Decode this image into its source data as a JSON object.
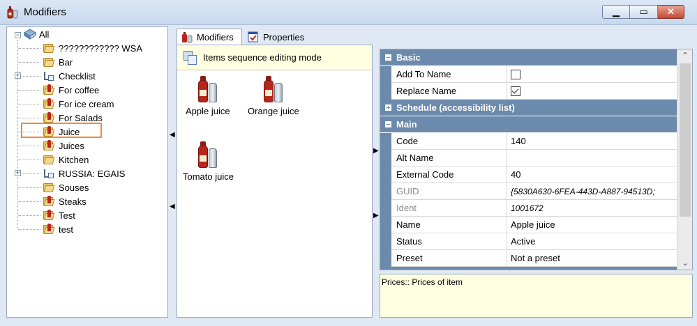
{
  "window": {
    "title": "Modifiers"
  },
  "tree": {
    "root": "All",
    "items": [
      {
        "label": "???????????? WSA",
        "icon": "folder-icon",
        "expander": false
      },
      {
        "label": "Bar",
        "icon": "folder-icon",
        "expander": false
      },
      {
        "label": "Checklist",
        "icon": "list-icon",
        "expander": true
      },
      {
        "label": "For coffee",
        "icon": "modifier-folder-icon",
        "expander": false
      },
      {
        "label": "For ice cream",
        "icon": "modifier-folder-icon",
        "expander": false
      },
      {
        "label": "For Salads",
        "icon": "modifier-folder-icon",
        "expander": false
      },
      {
        "label": "Juice",
        "icon": "modifier-folder-icon",
        "expander": false,
        "selected": true
      },
      {
        "label": "Juices",
        "icon": "modifier-folder-icon",
        "expander": false
      },
      {
        "label": "Kitchen",
        "icon": "folder-icon",
        "expander": false
      },
      {
        "label": "RUSSIA: EGAIS",
        "icon": "list-icon",
        "expander": true
      },
      {
        "label": "Souses",
        "icon": "folder-icon",
        "expander": false
      },
      {
        "label": "Steaks",
        "icon": "modifier-folder-icon",
        "expander": false
      },
      {
        "label": "Test",
        "icon": "modifier-folder-icon",
        "expander": false
      },
      {
        "label": "test",
        "icon": "modifier-folder-icon",
        "expander": false
      }
    ]
  },
  "tabs": {
    "modifiers": "Modifiers",
    "properties": "Properties"
  },
  "mode_bar": {
    "text": "Items sequence editing mode"
  },
  "items": [
    {
      "label": "Apple juice"
    },
    {
      "label": "Orange juice"
    },
    {
      "label": "Tomato juice"
    }
  ],
  "grid": {
    "sections": {
      "basic": "Basic",
      "schedule": "Schedule (accessibility list)",
      "main": "Main"
    },
    "basic": [
      {
        "name": "Add To Name",
        "checked": false
      },
      {
        "name": "Replace Name",
        "checked": true
      }
    ],
    "main": [
      {
        "name": "Code",
        "value": "140"
      },
      {
        "name": "Alt Name",
        "value": ""
      },
      {
        "name": "External Code",
        "value": "40"
      },
      {
        "name": "GUID",
        "value": "{5830A630-6FEA-443D-A887-94513D;"
      },
      {
        "name": "Ident",
        "value": "1001672"
      },
      {
        "name": "Name",
        "value": "Apple juice"
      },
      {
        "name": "Status",
        "value": "Active"
      },
      {
        "name": "Preset",
        "value": "Not a preset"
      }
    ]
  },
  "description": {
    "text": "Prices:: Prices of item"
  },
  "colors": {
    "section": "#6c8aab",
    "highlight": "#ef8a3e",
    "info_bg": "#ffffe1"
  }
}
